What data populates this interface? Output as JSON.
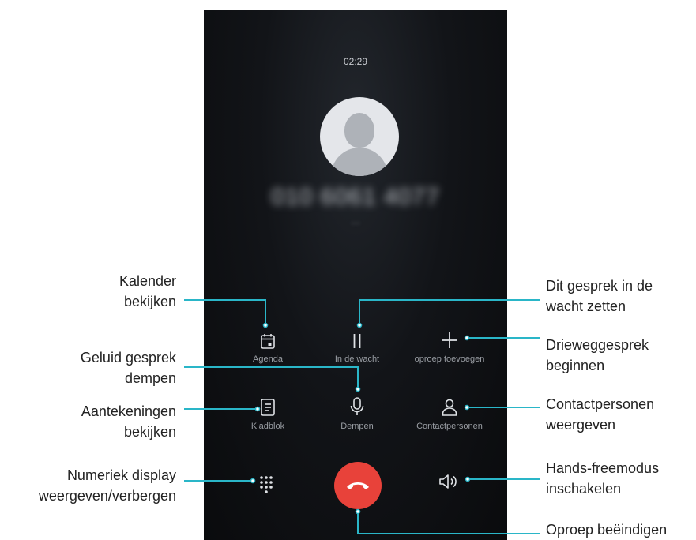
{
  "call": {
    "timer": "02:29",
    "number": "010 6061 4077",
    "status": "···"
  },
  "buttons": {
    "agenda": "Agenda",
    "hold": "In de wacht",
    "add_call": "oproep toevoegen",
    "notepad": "Kladblok",
    "mute": "Dempen",
    "contacts": "Contactpersonen"
  },
  "callouts": {
    "calendar": [
      "Kalender",
      "bekijken"
    ],
    "mute": [
      "Geluid gesprek",
      "dempen"
    ],
    "notes": [
      "Aantekeningen",
      "bekijken"
    ],
    "dialpad": [
      "Numeriek display",
      "weergeven/verbergen"
    ],
    "hold": [
      "Dit gesprek in de",
      "wacht zetten"
    ],
    "add_call": [
      "Drieweggesprek",
      "beginnen"
    ],
    "contacts": [
      "Contactpersonen",
      "weergeven"
    ],
    "speaker": [
      "Hands-freemodus",
      "inschakelen"
    ],
    "end": [
      "Oproep beëindigen"
    ]
  },
  "colors": {
    "accent_line": "#2ab6c8",
    "end_call": "#e8423a",
    "screen_bg": "#0f1114"
  },
  "icons": [
    "calendar-icon",
    "pause-icon",
    "plus-icon",
    "notepad-icon",
    "microphone-icon",
    "person-icon",
    "dialpad-icon",
    "speaker-icon",
    "hang-up-icon"
  ]
}
